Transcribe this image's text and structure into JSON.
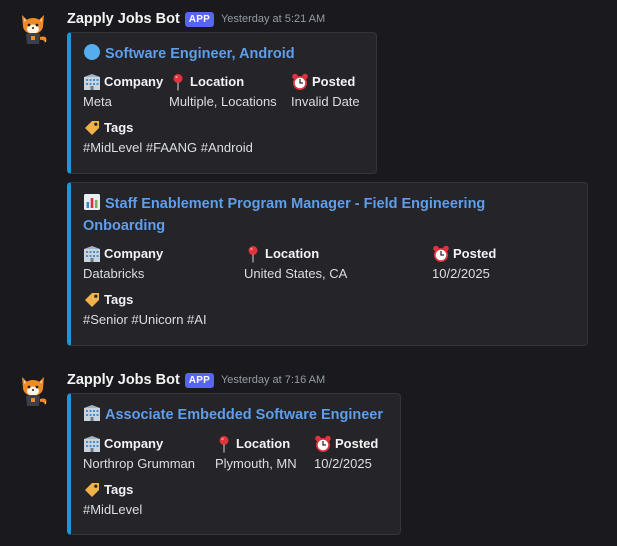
{
  "messages": [
    {
      "username": "Zapply Jobs Bot",
      "badge": "APP",
      "timestamp": "Yesterday at 5:21 AM",
      "embeds": [
        {
          "title_icon": "blue-circle-icon",
          "title_line1": "Software Engineer, Android",
          "title_line2": "",
          "fields": [
            {
              "icon": "office-building-icon",
              "name": "Company",
              "value": "Meta"
            },
            {
              "icon": "round-pushpin-icon",
              "name": "Location",
              "value": "Multiple, Locations"
            },
            {
              "icon": "alarm-clock-icon",
              "name": "Posted",
              "value": "Invalid Date"
            }
          ],
          "tags": {
            "icon": "label-tag-icon",
            "name": "Tags",
            "value": "#MidLevel #FAANG #Android"
          }
        },
        {
          "title_icon": "bar-chart-icon",
          "title_line1": "Staff Enablement Program Manager - Field Engineering",
          "title_line2": "Onboarding",
          "fields": [
            {
              "icon": "office-building-icon",
              "name": "Company",
              "value": "Databricks"
            },
            {
              "icon": "round-pushpin-icon",
              "name": "Location",
              "value": "United States, CA"
            },
            {
              "icon": "alarm-clock-icon",
              "name": "Posted",
              "value": "10/2/2025"
            }
          ],
          "tags": {
            "icon": "label-tag-icon",
            "name": "Tags",
            "value": "#Senior #Unicorn #AI"
          }
        }
      ]
    },
    {
      "username": "Zapply Jobs Bot",
      "badge": "APP",
      "timestamp": "Yesterday at 7:16 AM",
      "embeds": [
        {
          "title_icon": "office-building-icon",
          "title_line1": "Associate Embedded Software Engineer",
          "title_line2": "",
          "fields": [
            {
              "icon": "office-building-icon",
              "name": "Company",
              "value": "Northrop Grumman"
            },
            {
              "icon": "round-pushpin-icon",
              "name": "Location",
              "value": "Plymouth, MN"
            },
            {
              "icon": "alarm-clock-icon",
              "name": "Posted",
              "value": "10/2/2025"
            }
          ],
          "tags": {
            "icon": "label-tag-icon",
            "name": "Tags",
            "value": "#MidLevel"
          }
        }
      ]
    }
  ],
  "colors": {
    "background": "#1a1a1e",
    "embed_background": "#242429",
    "embed_accent": "#1e96d6",
    "link": "#5e9eea",
    "badge": "#5865f2"
  }
}
